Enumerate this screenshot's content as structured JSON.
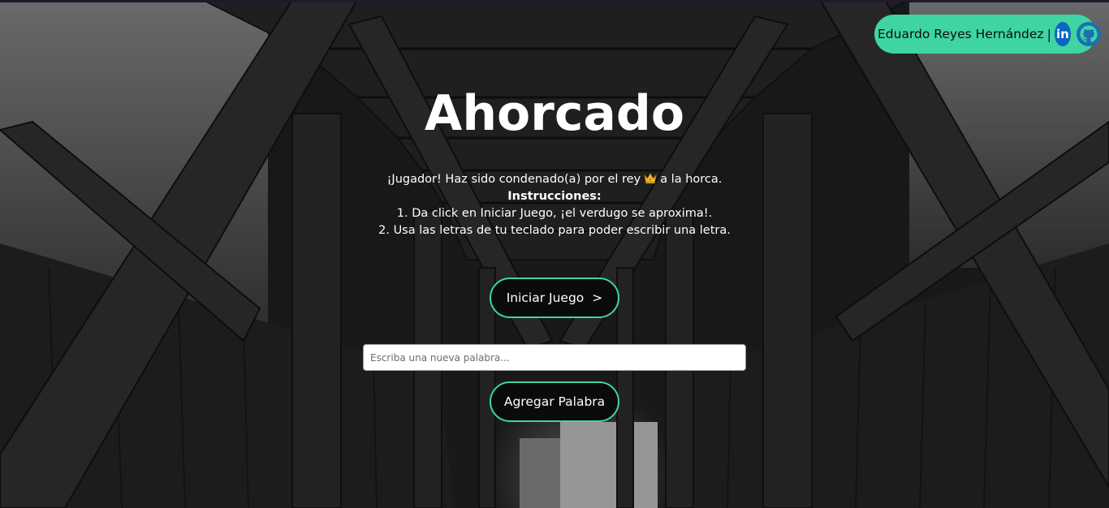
{
  "header": {
    "author_name": "Eduardo Reyes Hernández",
    "separator": "|",
    "linkedin_icon": "linkedin-icon",
    "github_icon": "github-icon",
    "accent_color": "#3ed5a3"
  },
  "main": {
    "title": "Ahorcado",
    "intro_before": "¡Jugador! Haz sido condenado(a) por el rey",
    "intro_icon": "crown-icon",
    "intro_after": "a la horca.",
    "instructions_heading": "Instrucciones:",
    "step_1": "1. Da click en Iniciar Juego, ¡el verdugo se aproxima!.",
    "step_2": "2. Usa las letras de tu teclado para poder escribir una letra.",
    "start_button_label": "Iniciar Juego",
    "start_button_arrow": ">",
    "word_input": {
      "placeholder": "Escriba una nueva palabra...",
      "value": ""
    },
    "add_word_button_label": "Agregar Palabra"
  }
}
